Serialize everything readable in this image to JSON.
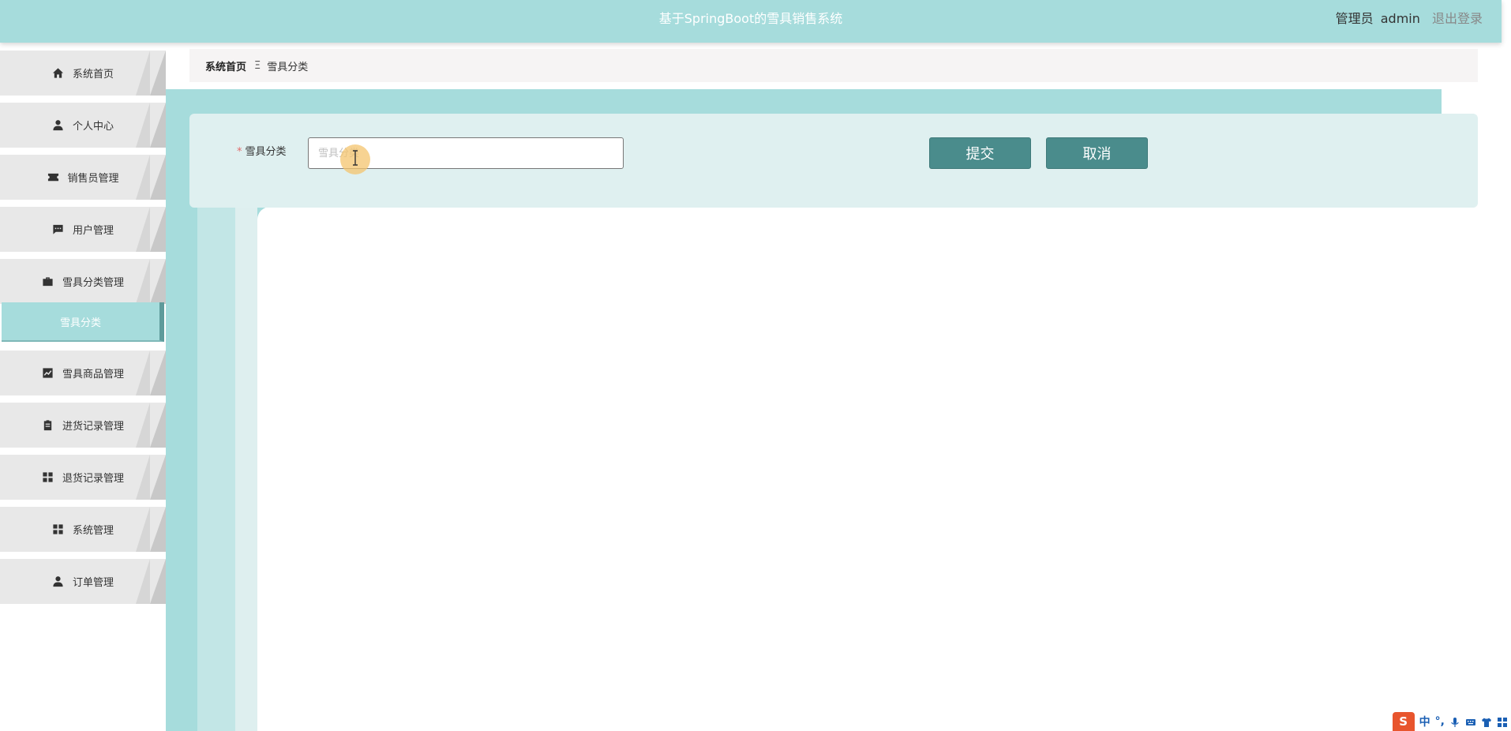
{
  "header": {
    "title": "基于SpringBoot的雪具销售系统",
    "user_role": "管理员",
    "user_name": "admin",
    "logout_label": "退出登录"
  },
  "sidebar": {
    "items": [
      {
        "label": "系统首页",
        "icon": "home-icon"
      },
      {
        "label": "个人中心",
        "icon": "person-icon"
      },
      {
        "label": "销售员管理",
        "icon": "ticket-icon"
      },
      {
        "label": "用户管理",
        "icon": "chat-icon"
      },
      {
        "label": "雪具分类管理",
        "icon": "briefcase-icon"
      },
      {
        "label": "雪具商品管理",
        "icon": "chart-icon"
      },
      {
        "label": "进货记录管理",
        "icon": "clipboard-icon"
      },
      {
        "label": "退货记录管理",
        "icon": "grid-icon"
      },
      {
        "label": "系统管理",
        "icon": "grid-icon"
      },
      {
        "label": "订单管理",
        "icon": "person-icon"
      }
    ],
    "active_sub": "雪具分类"
  },
  "breadcrumb": {
    "home": "系统首页",
    "separator": "Ξ",
    "current": "雪具分类"
  },
  "form": {
    "required_mark": "*",
    "field_label": "雪具分类",
    "field_value": "",
    "field_placeholder": "雪具分类",
    "submit_label": "提交",
    "cancel_label": "取消"
  },
  "tray": {
    "ime_logo": "S",
    "ime_mode": "中",
    "ime_punct": "°,"
  },
  "colors": {
    "accent": "#a6dcdc",
    "button": "#4a8c8c",
    "required": "#e06a6a"
  }
}
